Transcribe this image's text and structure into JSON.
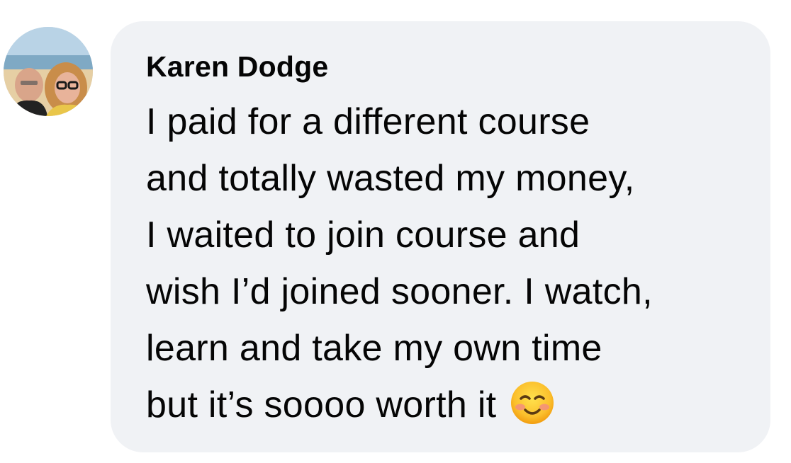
{
  "comment": {
    "author": "Karen Dodge",
    "avatar_icon": "profile-photo-avatar",
    "lines": [
      "I paid for a different course",
      "and totally wasted my money,",
      "I waited to join course and",
      "wish I’d joined sooner. I watch,",
      "learn and take my own time",
      "but it’s soooo worth it"
    ],
    "emoji": "smiling-face-with-smiling-eyes-icon"
  },
  "colors": {
    "bubble_bg": "#f0f2f5",
    "text": "#050505",
    "page_bg": "#ffffff"
  }
}
